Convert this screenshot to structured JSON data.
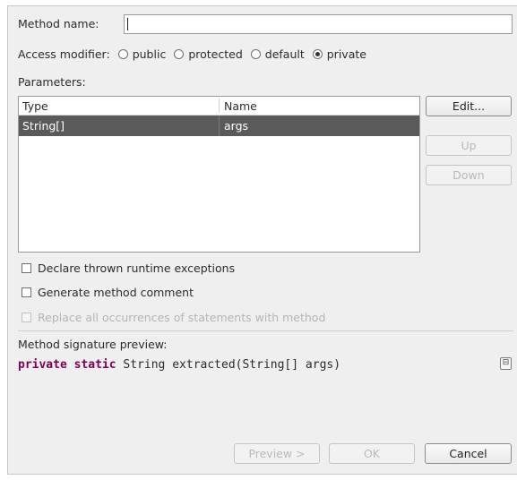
{
  "method_name": {
    "label": "Method name:",
    "value": ""
  },
  "access": {
    "label": "Access modifier:",
    "options": [
      {
        "label": "public",
        "checked": false
      },
      {
        "label": "protected",
        "checked": false
      },
      {
        "label": "default",
        "checked": false
      },
      {
        "label": "private",
        "checked": true
      }
    ]
  },
  "parameters": {
    "label": "Parameters:",
    "columns": [
      "Type",
      "Name"
    ],
    "rows": [
      {
        "type": "String[]",
        "name": "args",
        "selected": true
      }
    ]
  },
  "buttons": {
    "edit": "Edit...",
    "up": "Up",
    "down": "Down",
    "preview": "Preview >",
    "ok": "OK",
    "cancel": "Cancel"
  },
  "options": {
    "declare_exceptions": "Declare thrown runtime exceptions",
    "generate_comment": "Generate method comment",
    "replace_occurrences": "Replace all occurrences of statements with method"
  },
  "signature": {
    "label": "Method signature preview:",
    "kw1": "private",
    "kw2": "static",
    "rest": "String extracted(String[] args)"
  },
  "icons": {
    "signature_toggle": "collapse-icon"
  },
  "colors": {
    "keyword": "#7f0055",
    "selection": "#5a5a5a"
  }
}
